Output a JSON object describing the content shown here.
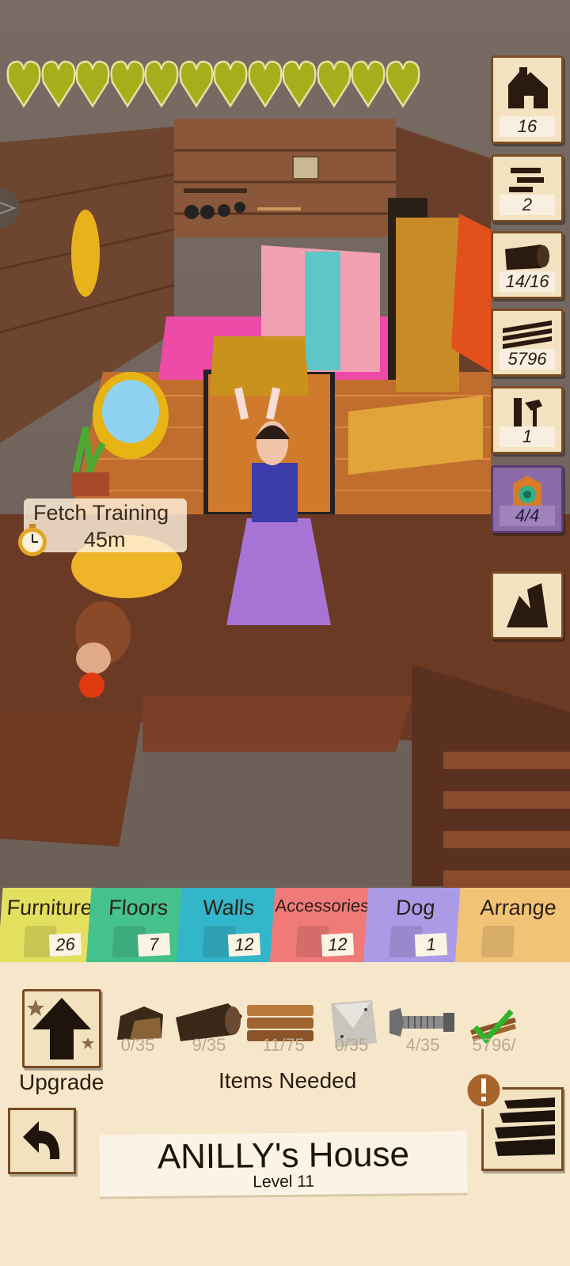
{
  "hud": {
    "hearts_filled": 12,
    "hearts_total": 12,
    "heart_color": "#a8ad1c",
    "side_buttons": [
      {
        "name": "house",
        "count": "16",
        "icon": "house-icon"
      },
      {
        "name": "blueprint",
        "count": "2",
        "icon": "plank-stack-icon"
      },
      {
        "name": "logs",
        "count": "14/16",
        "icon": "log-icon"
      },
      {
        "name": "planks",
        "count": "5796",
        "icon": "planks-icon"
      },
      {
        "name": "workers",
        "count": "1",
        "icon": "hammer-worker-icon"
      },
      {
        "name": "rug",
        "count": "4/4",
        "icon": "rug-icon"
      },
      {
        "name": "cliff",
        "count": "",
        "icon": "cliff-icon"
      }
    ]
  },
  "bubble": {
    "title": "Fetch Training",
    "time": "45m"
  },
  "tabs": [
    {
      "label": "Furniture",
      "count": "26",
      "color": "#e4e05f"
    },
    {
      "label": "Floors",
      "count": "7",
      "color": "#45c18c"
    },
    {
      "label": "Walls",
      "count": "12",
      "color": "#33b6c9"
    },
    {
      "label": "Accessories",
      "count": "12",
      "color": "#f07a78"
    },
    {
      "label": "Dog",
      "count": "1",
      "color": "#ab9be7"
    },
    {
      "label": "Arrange",
      "count": "",
      "color": "#f2c276"
    }
  ],
  "materials": [
    {
      "icon": "stone-icon",
      "count": "0/35"
    },
    {
      "icon": "log-icon",
      "count": "9/35"
    },
    {
      "icon": "planks-icon",
      "count": "11/75"
    },
    {
      "icon": "metal-plate-icon",
      "count": "0/35"
    },
    {
      "icon": "bolt-icon",
      "count": "4/35"
    },
    {
      "icon": "check-planks-icon",
      "count": "5796/"
    }
  ],
  "panel": {
    "upgrade_label": "Upgrade",
    "items_needed_label": "Items Needed",
    "house_name": "ANILLY's House",
    "house_level": "Level 11"
  }
}
